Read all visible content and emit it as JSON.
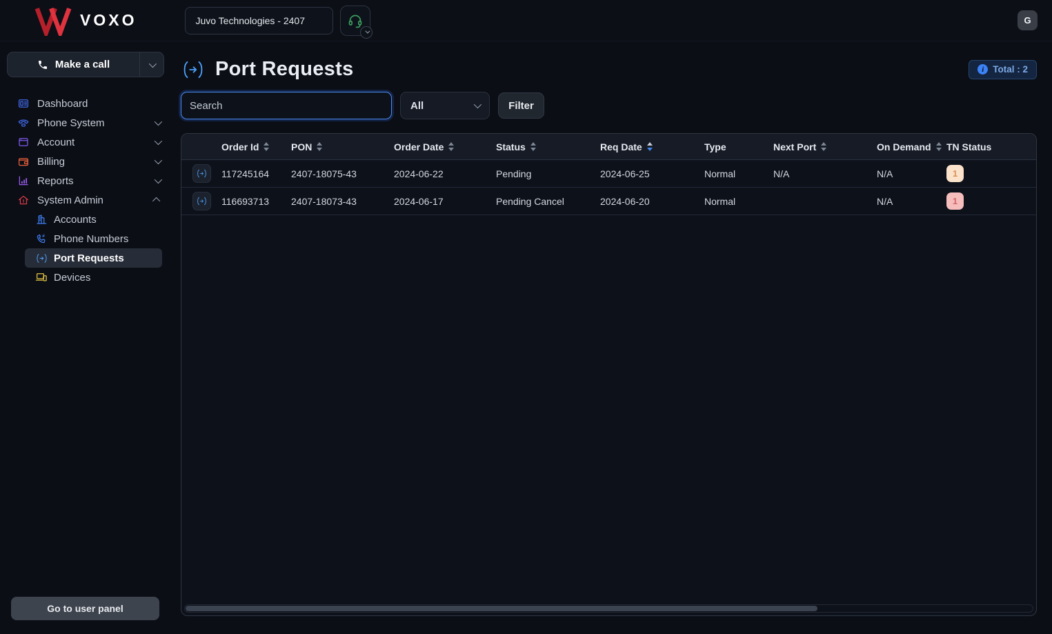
{
  "colors": {
    "accent": "#3b82f6",
    "brand_red": "#d92b33",
    "page_bg": "#0b0e15"
  },
  "header": {
    "brand": "VOXO",
    "account_selector": "Juvo Technologies - 2407",
    "avatar_initial": "G"
  },
  "sidebar": {
    "make_call_label": "Make a call",
    "items": [
      {
        "label": "Dashboard",
        "icon": "dashboard-icon",
        "icon_color": "#4169e8",
        "has_chevron": false
      },
      {
        "label": "Phone System",
        "icon": "phone-system-icon",
        "icon_color": "#4169e8",
        "has_chevron": true,
        "expanded": false
      },
      {
        "label": "Account",
        "icon": "account-icon",
        "icon_color": "#7e5bef",
        "has_chevron": true,
        "expanded": false
      },
      {
        "label": "Billing",
        "icon": "billing-icon",
        "icon_color": "#e8603c",
        "has_chevron": true,
        "expanded": false
      },
      {
        "label": "Reports",
        "icon": "reports-icon",
        "icon_color": "#9a5cf0",
        "has_chevron": true,
        "expanded": false
      },
      {
        "label": "System Admin",
        "icon": "system-admin-icon",
        "icon_color": "#d63a4a",
        "has_chevron": true,
        "expanded": true
      }
    ],
    "system_admin_subitems": [
      {
        "label": "Accounts",
        "icon": "accounts-icon",
        "icon_color": "#3f7df0",
        "active": false
      },
      {
        "label": "Phone Numbers",
        "icon": "phone-numbers-icon",
        "icon_color": "#3f7df0",
        "active": false
      },
      {
        "label": "Port Requests",
        "icon": "port-requests-icon",
        "icon_color": "#4da3ff",
        "active": true
      },
      {
        "label": "Devices",
        "icon": "devices-icon",
        "icon_color": "#e5c544",
        "active": false
      }
    ],
    "footer_button_label": "Go to user panel"
  },
  "main": {
    "title": "Port Requests",
    "total_badge_label": "Total : 2",
    "search_placeholder": "Search",
    "type_filter_value": "All",
    "filter_button_label": "Filter",
    "table": {
      "columns": [
        {
          "label": "Order Id",
          "sortable": true,
          "sort": "none"
        },
        {
          "label": "PON",
          "sortable": true,
          "sort": "none"
        },
        {
          "label": "Order Date",
          "sortable": true,
          "sort": "none"
        },
        {
          "label": "Status",
          "sortable": true,
          "sort": "none"
        },
        {
          "label": "Req Date",
          "sortable": true,
          "sort": "desc"
        },
        {
          "label": "Type",
          "sortable": false
        },
        {
          "label": "Next Port",
          "sortable": true,
          "sort": "none"
        },
        {
          "label": "On Demand",
          "sortable": true,
          "sort": "none"
        },
        {
          "label": "TN Status",
          "sortable": false
        }
      ],
      "rows": [
        {
          "order_id": "117245164",
          "pon": "2407-18075-43",
          "order_date": "2024-06-22",
          "status": "Pending",
          "req_date": "2024-06-25",
          "type": "Normal",
          "next_port": "N/A",
          "on_demand": "N/A",
          "tn_status": {
            "count": "1",
            "bg": "#fbe3cb",
            "color": "#dd9055"
          }
        },
        {
          "order_id": "116693713",
          "pon": "2407-18073-43",
          "order_date": "2024-06-17",
          "status": "Pending Cancel",
          "req_date": "2024-06-20",
          "type": "Normal",
          "next_port": "",
          "on_demand": "N/A",
          "tn_status": {
            "count": "1",
            "bg": "#f6bdbd",
            "color": "#d46666"
          }
        }
      ]
    },
    "scrollbar": {
      "thumb_ratio": 0.745
    }
  }
}
